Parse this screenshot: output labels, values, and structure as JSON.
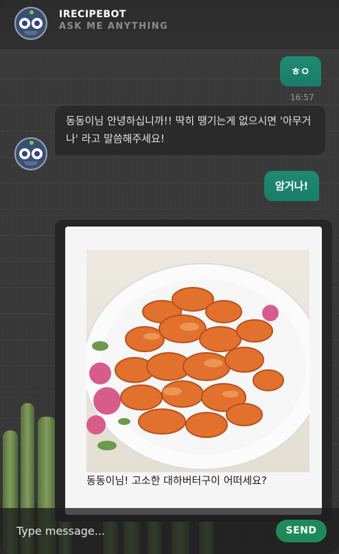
{
  "header": {
    "bot_name": "IRECIPEBOT",
    "subtitle": "ASK ME ANYTHING",
    "avatar_icon": "robot-face-icon"
  },
  "messages": [
    {
      "from": "user",
      "text": "ㅎㅇ",
      "time": "16:57"
    },
    {
      "from": "bot",
      "text": "동동이님 안녕하십니까!! 딱히 땡기는게 없으시면 '아무거나' 라고 말씀해주세요!"
    },
    {
      "from": "user",
      "text": "암거나!"
    },
    {
      "from": "bot",
      "type": "card",
      "image_icon": "buttered-shrimp-dish-image",
      "text": "동동이님! 고소한 대하버터구이 어떠세요?"
    }
  ],
  "composer": {
    "placeholder": "Type message...",
    "send_label": "SEND"
  },
  "colors": {
    "accent": "#1e8a5a",
    "user_bubble": "#1f8a72",
    "bot_bubble": "#2a2a2a",
    "header_bg": "#2c2c2c"
  }
}
